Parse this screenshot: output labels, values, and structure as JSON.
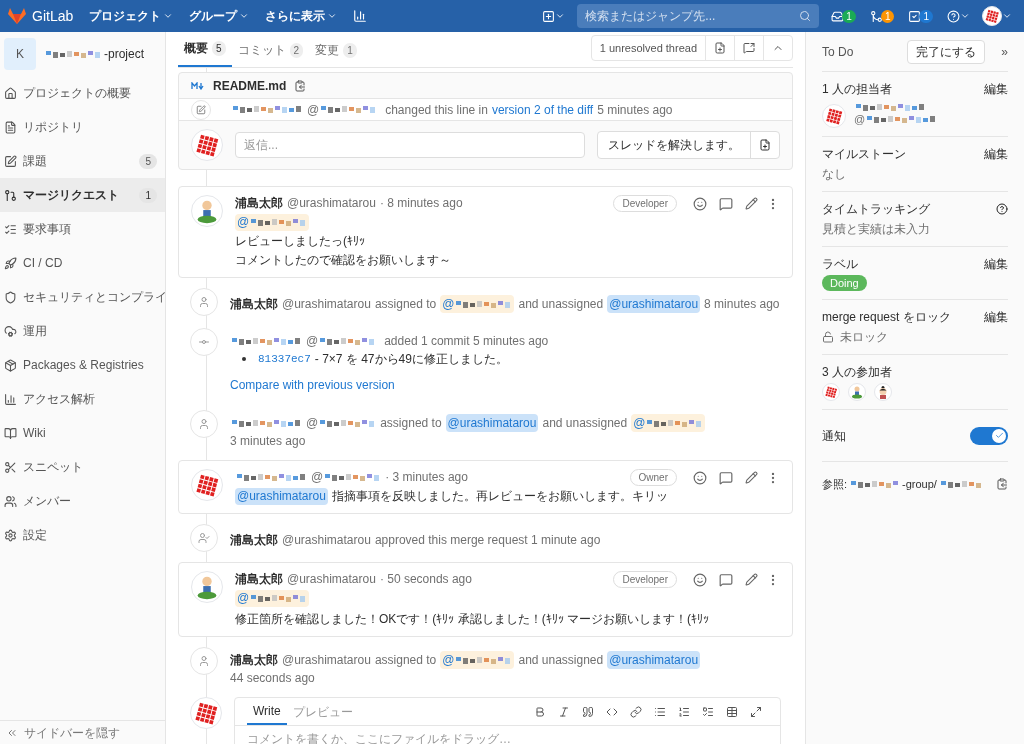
{
  "navbar": {
    "logo": "GitLab",
    "menus": [
      "プロジェクト",
      "グループ",
      "さらに表示"
    ],
    "search": {
      "placeholder": "検索またはジャンプ先..."
    },
    "counters": [
      {
        "count": "1",
        "color": "#1aaa55"
      },
      {
        "count": "1",
        "color": "#fc9403"
      },
      {
        "count": "1",
        "color": "#1f78d1"
      }
    ]
  },
  "sidebar": {
    "project": {
      "avatar": "K",
      "name": "-project"
    },
    "items": [
      {
        "label": "プロジェクトの概要",
        "selected": false
      },
      {
        "label": "リポジトリ",
        "selected": false
      },
      {
        "label": "課題",
        "count": "5",
        "selected": false
      },
      {
        "label": "マージリクエスト",
        "count": "1",
        "selected": true
      },
      {
        "label": "要求事項",
        "selected": false
      },
      {
        "label": "CI / CD",
        "selected": false
      },
      {
        "label": "セキュリティとコンプライ",
        "selected": false
      },
      {
        "label": "運用",
        "selected": false
      },
      {
        "label": "Packages & Registries",
        "selected": false
      },
      {
        "label": "アクセス解析",
        "selected": false
      },
      {
        "label": "Wiki",
        "selected": false
      },
      {
        "label": "スニペット",
        "selected": false
      },
      {
        "label": "メンバー",
        "selected": false
      },
      {
        "label": "設定",
        "selected": false
      }
    ],
    "collapse": "サイドバーを隠す"
  },
  "tabs": [
    {
      "label": "概要",
      "count": "5",
      "selected": true
    },
    {
      "label": "コミット",
      "count": "2",
      "selected": false
    },
    {
      "label": "変更",
      "count": "1",
      "selected": false
    }
  ],
  "thread_bar": {
    "unresolved": "1 unresolved thread"
  },
  "diff_thread": {
    "file": "README.md",
    "note": {
      "handle": "@",
      "text": "changed this line in",
      "link": "version 2 of the diff",
      "time": "5 minutes ago"
    },
    "reply_placeholder": "返信...",
    "resolve": "スレッドを解決します。"
  },
  "notes": [
    {
      "kind": "comment",
      "author": {
        "name": "浦島太郎",
        "redacted": false,
        "handle": "@urashimatarou"
      },
      "time": "· 8 minutes ago",
      "role": "Developer",
      "lines": [
        [
          {
            "kind": "mention",
            "text": "@",
            "redacted": true
          }
        ],
        [
          {
            "kind": "text",
            "text": "レビューしましたっ(ｷﾘｯ"
          }
        ],
        [
          {
            "kind": "text",
            "text": "コメントしたので確認をお願いします～"
          }
        ]
      ]
    },
    {
      "kind": "assignment",
      "author": {
        "name": "浦島太郎",
        "redacted": false,
        "handle": "@urashimatarou"
      },
      "parts": [
        {
          "kind": "text",
          "text": "assigned to"
        },
        {
          "kind": "mention",
          "text": "@",
          "redacted": true
        },
        {
          "kind": "text",
          "text": "and unassigned"
        },
        {
          "kind": "mention",
          "text": "@urashimatarou",
          "redacted": false
        },
        {
          "kind": "text",
          "text": "8 minutes ago"
        }
      ]
    },
    {
      "kind": "commit",
      "author": {
        "redacted": true,
        "handle": "@"
      },
      "text": "added 1 commit 5 minutes ago",
      "sha": "81337ec7",
      "message": "- 7×7 を 47から49に修正しました。",
      "compare": "Compare with previous version"
    },
    {
      "kind": "assignment",
      "author": {
        "redacted": true,
        "handle": "@"
      },
      "parts": [
        {
          "kind": "text",
          "text": "assigned to"
        },
        {
          "kind": "mention",
          "text": "@urashimatarou",
          "redacted": false
        },
        {
          "kind": "text",
          "text": "and unassigned"
        },
        {
          "kind": "mention",
          "text": "@",
          "redacted": true
        },
        {
          "kind": "text",
          "text": "3 minutes ago"
        }
      ]
    },
    {
      "kind": "comment",
      "author": {
        "redacted": true,
        "handle": "@"
      },
      "time": "· 3 minutes ago",
      "role": "Owner",
      "lines": [
        [
          {
            "kind": "mention",
            "text": "@urashimatarou",
            "redacted": false
          },
          {
            "kind": "text",
            "text": "指摘事項を反映しました。再レビューをお願いします。キリッ"
          }
        ]
      ]
    },
    {
      "kind": "approval",
      "author": {
        "name": "浦島太郎",
        "redacted": false,
        "handle": "@urashimatarou"
      },
      "parts": [
        {
          "kind": "text",
          "text": "approved this merge request 1 minute ago"
        }
      ]
    },
    {
      "kind": "comment",
      "author": {
        "name": "浦島太郎",
        "redacted": false,
        "handle": "@urashimatarou"
      },
      "time": "· 50 seconds ago",
      "role": "Developer",
      "lines": [
        [
          {
            "kind": "mention",
            "text": "@",
            "redacted": true
          },
          {
            "kind": "text",
            "text": "修正箇所を確認しました！OKです！(ｷﾘｯ 承認しました！(ｷﾘｯ マージお願いします！(ｷﾘｯ"
          }
        ]
      ]
    },
    {
      "kind": "assignment",
      "author": {
        "name": "浦島太郎",
        "redacted": false,
        "handle": "@urashimatarou"
      },
      "parts": [
        {
          "kind": "text",
          "text": "assigned to"
        },
        {
          "kind": "mention",
          "text": "@",
          "redacted": true
        },
        {
          "kind": "text",
          "text": "and unassigned"
        },
        {
          "kind": "mention",
          "text": "@urashimatarou",
          "redacted": false
        },
        {
          "kind": "text",
          "text": "44 seconds ago"
        }
      ]
    }
  ],
  "composer": {
    "tabs": [
      {
        "label": "Write",
        "selected": true
      },
      {
        "label": "プレビュー",
        "selected": false
      }
    ],
    "placeholder": "コメントを書くか、ここにファイルをドラッグ…"
  },
  "right_sidebar": {
    "todo": "To Do",
    "done_button": "完了にする",
    "collapse": "»",
    "assignee": {
      "title": "1 人の担当者",
      "edit": "編集",
      "handle": "@"
    },
    "milestone": {
      "title": "マイルストーン",
      "edit": "編集",
      "value": "なし"
    },
    "time_tracking": {
      "title": "タイムトラッキング",
      "value": "見積と実績は未入力"
    },
    "labels": {
      "title": "ラベル",
      "edit": "編集",
      "items": [
        {
          "text": "Doing",
          "color": "#5cb85c"
        }
      ]
    },
    "lock": {
      "title": "merge request をロック",
      "edit": "編集",
      "value": "未ロック",
      "locked": false
    },
    "participants": {
      "title": "3 人の参加者"
    },
    "notifications": {
      "title": "通知",
      "on": true
    },
    "reference": {
      "label": "参照:",
      "middle": "-group/"
    }
  }
}
